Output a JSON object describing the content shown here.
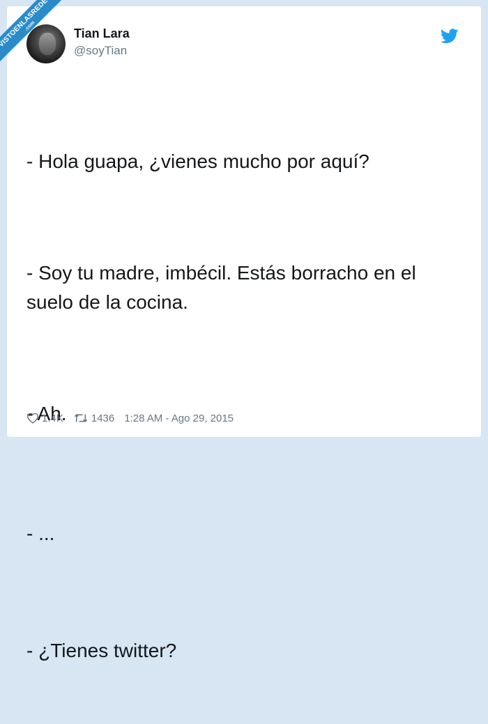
{
  "watermark": {
    "text": "VISTOENLASREDES",
    "suffix": ".com"
  },
  "tweet": {
    "author_name": "Tian Lara",
    "author_handle": "@soyTian",
    "lines": [
      "- Hola guapa, ¿vienes mucho por aquí?",
      "- Soy tu madre, imbécil. Estás borracho en el suelo de la cocina.",
      "- Ah.",
      "- ...",
      "- ¿Tienes twitter?"
    ],
    "likes": "1.4K",
    "retweets": "1436",
    "timestamp": "1:28 AM - Ago 29, 2015"
  },
  "icons": {
    "brand": "twitter-bird-icon",
    "like": "heart-icon",
    "retweet": "retweet-icon"
  },
  "colors": {
    "brand": "#1da1f2",
    "muted": "#657786",
    "text": "#14171a",
    "background": "#d7e6f2",
    "watermark": "#2a8bc9"
  }
}
